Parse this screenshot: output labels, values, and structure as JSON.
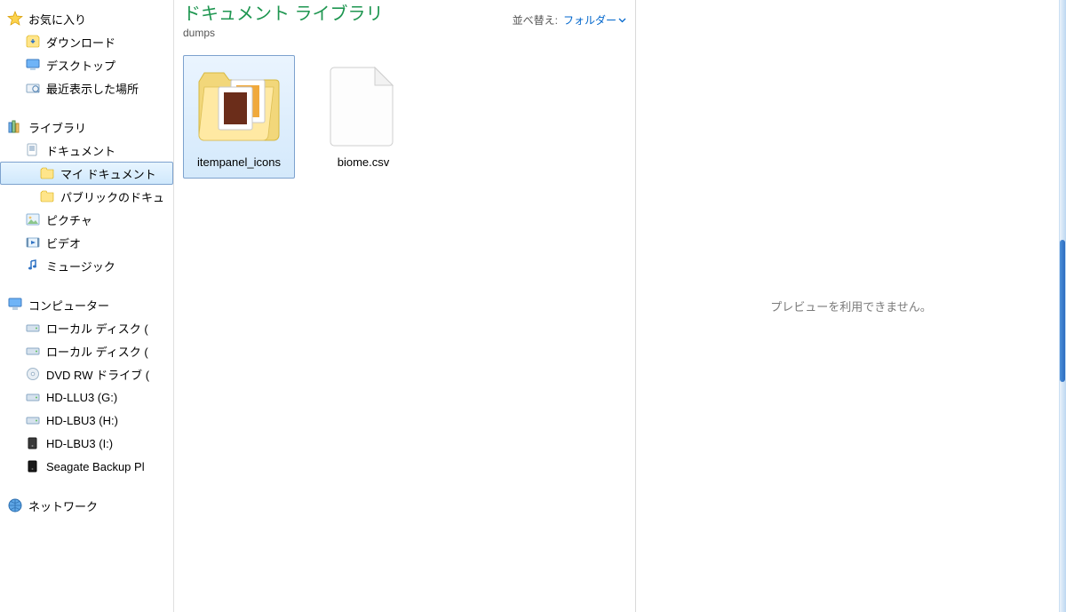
{
  "sidebar": {
    "favorites": {
      "label": "お気に入り",
      "items": [
        {
          "label": "ダウンロード",
          "icon": "downloads"
        },
        {
          "label": "デスクトップ",
          "icon": "desktop"
        },
        {
          "label": "最近表示した場所",
          "icon": "recent"
        }
      ]
    },
    "libraries": {
      "label": "ライブラリ",
      "items": [
        {
          "label": "ドキュメント",
          "icon": "documents",
          "children": [
            {
              "label": "マイ ドキュメント",
              "icon": "folder",
              "selected": true
            },
            {
              "label": "パブリックのドキュ",
              "icon": "folder"
            }
          ]
        },
        {
          "label": "ピクチャ",
          "icon": "pictures"
        },
        {
          "label": "ビデオ",
          "icon": "videos"
        },
        {
          "label": "ミュージック",
          "icon": "music"
        }
      ]
    },
    "computer": {
      "label": "コンピューター",
      "items": [
        {
          "label": "ローカル ディスク (",
          "icon": "hdd"
        },
        {
          "label": "ローカル ディスク (",
          "icon": "hdd"
        },
        {
          "label": "DVD RW ドライブ (",
          "icon": "dvd"
        },
        {
          "label": "HD-LLU3 (G:)",
          "icon": "hdd"
        },
        {
          "label": "HD-LBU3 (H:)",
          "icon": "hdd"
        },
        {
          "label": "HD-LBU3 (I:)",
          "icon": "ext"
        },
        {
          "label": "Seagate Backup Pl",
          "icon": "ext"
        }
      ]
    },
    "network": {
      "label": "ネットワーク"
    }
  },
  "content": {
    "library_title": "ドキュメント ライブラリ",
    "folder_name": "dumps",
    "sort_label": "並べ替え:",
    "sort_value": "フォルダー",
    "items": [
      {
        "name": "itempanel_icons",
        "type": "folder",
        "selected": true
      },
      {
        "name": "biome.csv",
        "type": "file"
      }
    ]
  },
  "preview": {
    "message": "プレビューを利用できません。"
  }
}
